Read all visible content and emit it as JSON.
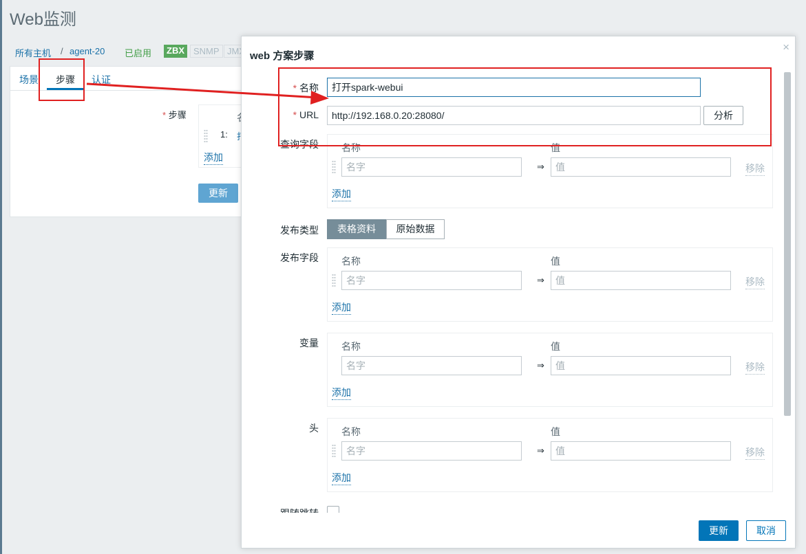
{
  "page": {
    "title": "Web监测"
  },
  "breadcrumb": {
    "all_hosts": "所有主机",
    "sep": "/",
    "host": "agent-20",
    "enabled": "已启用"
  },
  "tags": {
    "zbx": "ZBX",
    "snmp": "SNMP",
    "jmx": "JMX"
  },
  "tabs": [
    "场景",
    "步骤",
    "认证"
  ],
  "background_form": {
    "steps_required": "*",
    "steps_label": "步骤",
    "col_partial": "名",
    "row_num": "1:",
    "row_partial": "打",
    "add": "添加",
    "update": "更新"
  },
  "modal": {
    "title": "web 方案步骤",
    "close": "×",
    "required_mark": "*",
    "name_label": "名称",
    "name_value": "打开spark-webui",
    "url_label": "URL",
    "url_value": "http://192.168.0.20:28080/",
    "parse_button": "分析",
    "query_label": "查询字段",
    "col_name": "名称",
    "col_value": "值",
    "name_placeholder": "名字",
    "value_placeholder": "值",
    "arrow": "⇒",
    "remove": "移除",
    "add": "添加",
    "post_type_label": "发布类型",
    "post_type_options": [
      "表格资料",
      "原始数据"
    ],
    "post_fields_label": "发布字段",
    "variables_label": "变量",
    "headers_label": "头",
    "follow_redirects_label": "跟随跳转",
    "update_button": "更新",
    "cancel_button": "取消"
  },
  "colors": {
    "primary": "#0275b8",
    "annotation": "#e02020",
    "enabled": "#429e47",
    "zbx": "#59a85e"
  }
}
